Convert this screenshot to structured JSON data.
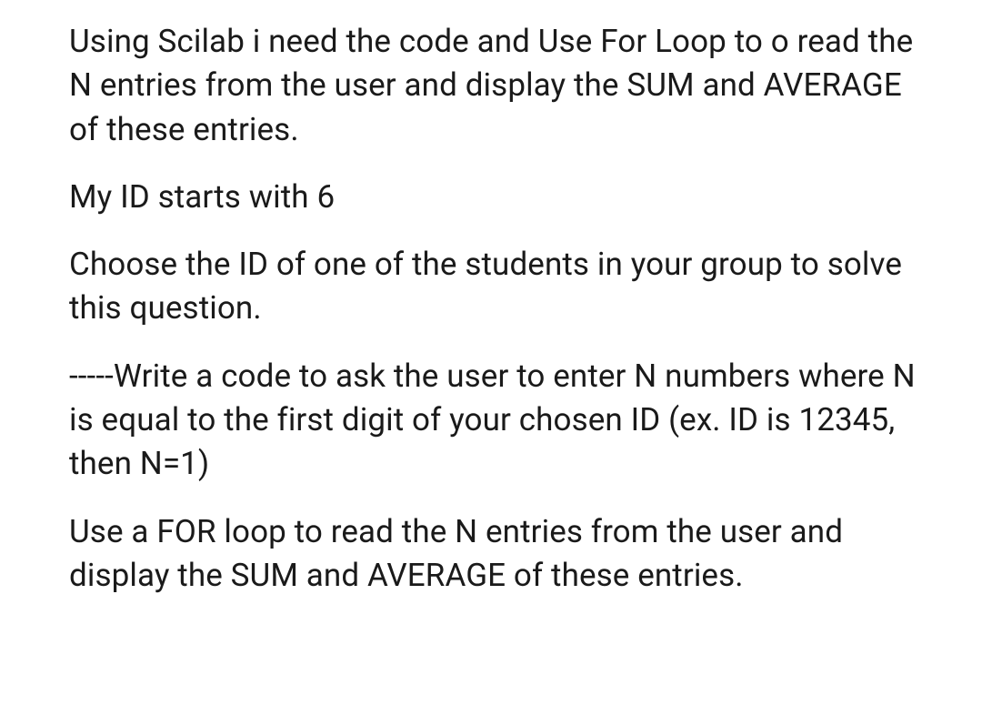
{
  "paragraphs": {
    "p1": "Using Scilab i need the code and Use For Loop to o read the N entries from the user and display the SUM and AVERAGE of these entries.",
    "p2": "My ID starts with 6",
    "p3": "Choose the ID of one of the students in your group to solve this question.",
    "p4": "-----Write a code to ask the user to enter N numbers where N is equal to the first digit of your chosen ID (ex. ID is 12345, then N=1)",
    "p5": "Use a FOR loop to read the N entries from the user and display the SUM and AVERAGE of these entries."
  }
}
